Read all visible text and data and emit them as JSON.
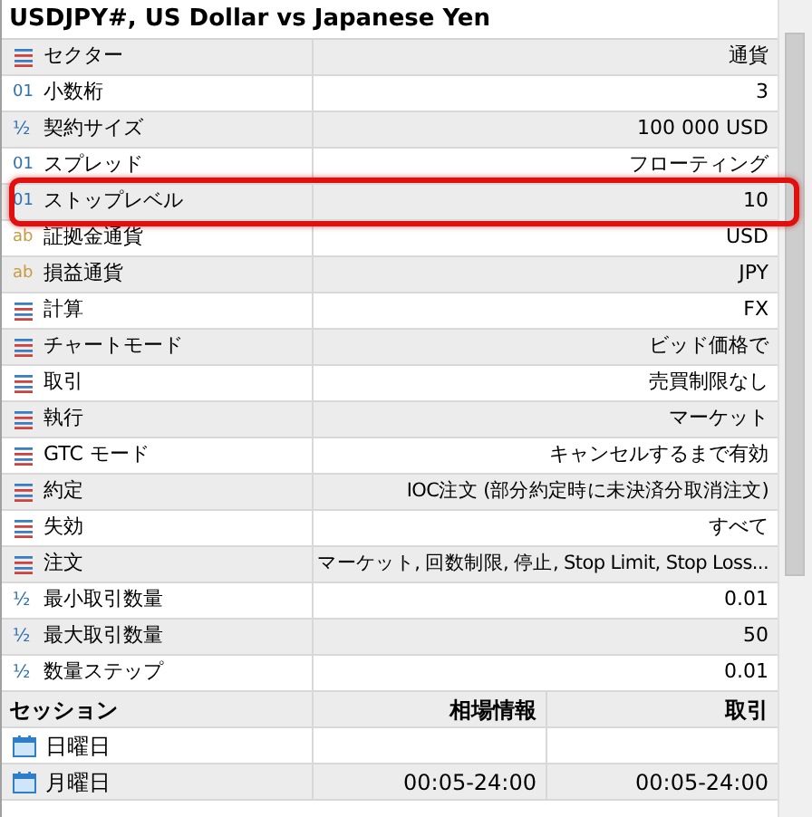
{
  "window": {
    "title": "USDJPY#, US Dollar vs Japanese Yen"
  },
  "properties": [
    {
      "kind": "enum",
      "label": "セクター",
      "value": "通貨",
      "highlighted": false
    },
    {
      "kind": "integer",
      "icon": "01",
      "label": "小数桁",
      "value": "3",
      "highlighted": false
    },
    {
      "kind": "decimal",
      "icon": "½",
      "label": "契約サイズ",
      "value": "100 000 USD",
      "highlighted": false
    },
    {
      "kind": "integer",
      "icon": "01",
      "label": "スプレッド",
      "value": "フローティング",
      "highlighted": false
    },
    {
      "kind": "integer",
      "icon": "01",
      "label": "ストップレベル",
      "value": "10",
      "highlighted": true
    },
    {
      "kind": "string",
      "icon": "ab",
      "label": "証拠金通貨",
      "value": "USD",
      "highlighted": false
    },
    {
      "kind": "string",
      "icon": "ab",
      "label": "損益通貨",
      "value": "JPY",
      "highlighted": false
    },
    {
      "kind": "enum",
      "label": "計算",
      "value": "FX",
      "highlighted": false
    },
    {
      "kind": "enum",
      "label": "チャートモード",
      "value": "ビッド価格で",
      "highlighted": false
    },
    {
      "kind": "enum",
      "label": "取引",
      "value": "売買制限なし",
      "highlighted": false
    },
    {
      "kind": "enum",
      "label": "執行",
      "value": "マーケット",
      "highlighted": false
    },
    {
      "kind": "enum",
      "label": "GTC モード",
      "value": "キャンセルするまで有効",
      "highlighted": false
    },
    {
      "kind": "enum",
      "label": "約定",
      "value": "IOC注文 (部分約定時に未決済分取消注文)",
      "highlighted": false
    },
    {
      "kind": "enum",
      "label": "失効",
      "value": "すべて",
      "highlighted": false
    },
    {
      "kind": "enum",
      "label": "注文",
      "value": "マーケット, 回数制限, 停止, Stop Limit, Stop Loss...",
      "highlighted": false
    },
    {
      "kind": "decimal",
      "icon": "½",
      "label": "最小取引数量",
      "value": "0.01",
      "highlighted": false
    },
    {
      "kind": "decimal",
      "icon": "½",
      "label": "最大取引数量",
      "value": "50",
      "highlighted": false
    },
    {
      "kind": "decimal",
      "icon": "½",
      "label": "数量ステップ",
      "value": "0.01",
      "highlighted": false
    }
  ],
  "sessions": {
    "columns": [
      "セッション",
      "相場情報",
      "取引"
    ],
    "rows": [
      {
        "day": "日曜日",
        "quotes": "",
        "trade": ""
      },
      {
        "day": "月曜日",
        "quotes": "00:05-24:00",
        "trade": "00:05-24:00"
      }
    ]
  }
}
